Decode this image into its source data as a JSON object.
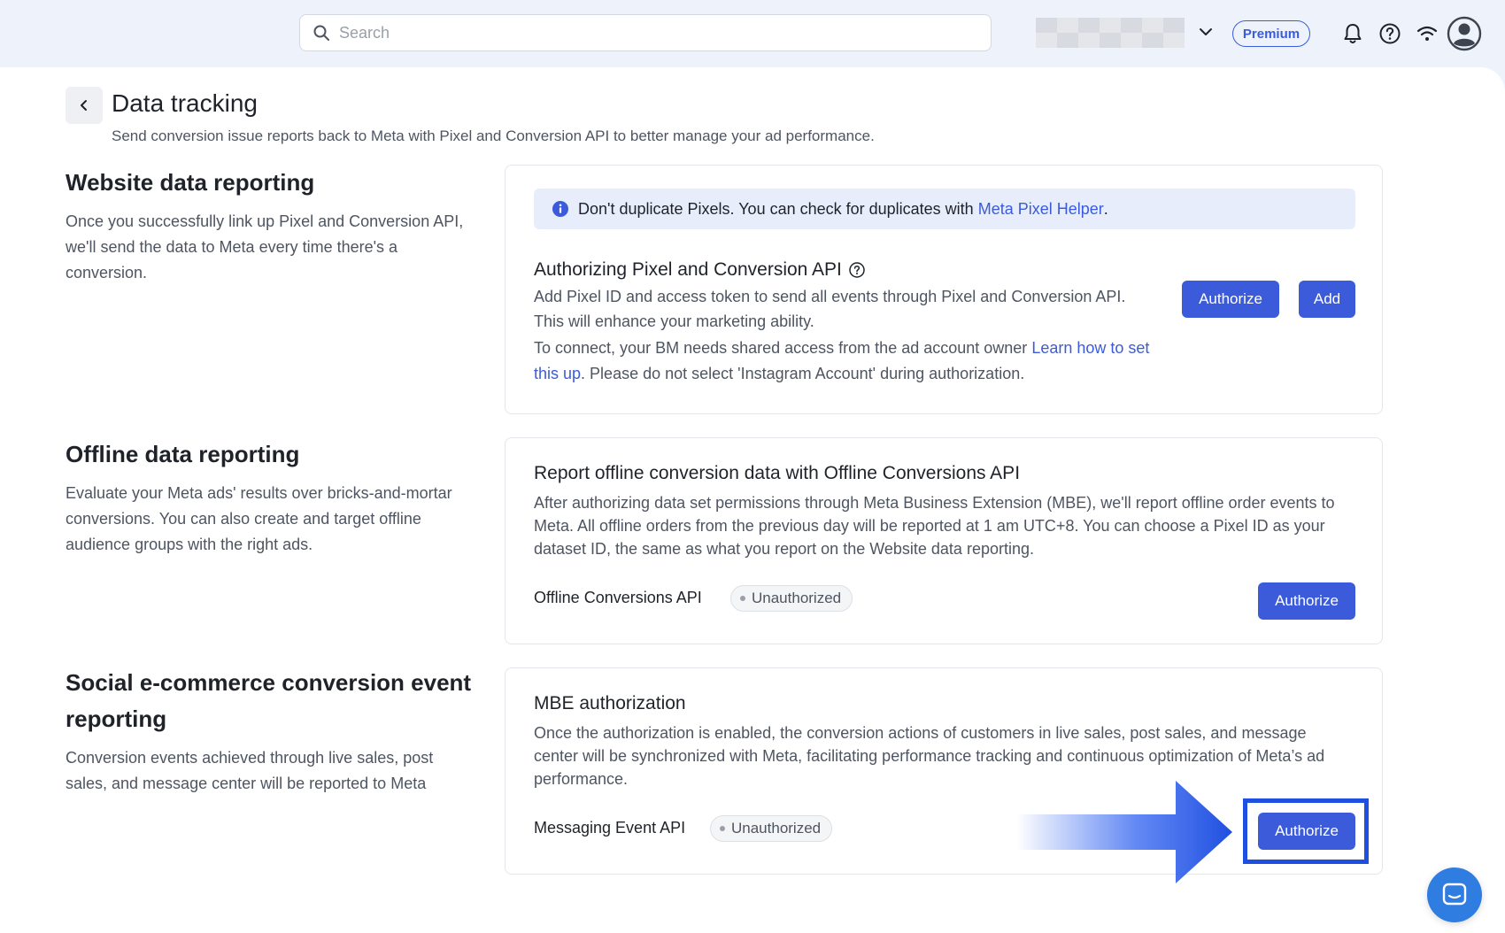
{
  "topbar": {
    "search_placeholder": "Search",
    "premium_label": "Premium",
    "icons": [
      "search-icon",
      "chevron-down-icon",
      "bell-icon",
      "help-icon",
      "wifi-icon",
      "user-avatar-icon"
    ]
  },
  "page": {
    "title": "Data tracking",
    "subtitle": "Send conversion issue reports back to Meta with Pixel and Conversion API to better manage your ad performance."
  },
  "sections": {
    "website": {
      "title": "Website data reporting",
      "desc": "Once you successfully link up Pixel and Conversion API, we'll send the data to Meta every time there's a conversion.",
      "notice_text": "Don't duplicate Pixels. You can check for duplicates with ",
      "notice_link": "Meta Pixel Helper",
      "notice_end": ".",
      "card_title": "Authorizing Pixel and Conversion API",
      "card_desc": "Add Pixel ID and access token to send all events through Pixel and Conversion API. This will enhance your marketing ability.",
      "connect_text": "To connect, your BM needs shared access from the ad account owner ",
      "connect_link": "Learn how to set this up",
      "connect_end": ". Please do not select 'Instagram Account' during authorization.",
      "authorize_label": "Authorize",
      "add_label": "Add"
    },
    "offline": {
      "title": "Offline data reporting",
      "desc": "Evaluate your Meta ads' results over bricks-and-mortar conversions. You can also create and target offline audience groups with the right ads.",
      "card_title": "Report offline conversion data with Offline Conversions API",
      "card_desc": "After authorizing data set permissions through Meta Business Extension (MBE), we'll report offline order events to Meta. All offline orders from the previous day will be reported at 1 am UTC+8. You can choose a Pixel ID as your dataset ID, the same as what you report on the Website data reporting.",
      "row_label": "Offline Conversions API",
      "status": "Unauthorized",
      "authorize_label": "Authorize"
    },
    "social": {
      "title": "Social e-commerce conversion event reporting",
      "desc": "Conversion events achieved through live sales, post sales, and message center will be reported to Meta",
      "card_title": "MBE authorization",
      "card_desc": "Once the authorization is enabled, the conversion actions of customers in live sales, post sales, and message center will be synchronized with Meta, facilitating performance tracking and continuous optimization of Meta’s ad performance.",
      "row_label": "Messaging Event API",
      "status": "Unauthorized",
      "authorize_label": "Authorize"
    }
  },
  "colors": {
    "accent": "#3b5bdb",
    "highlight": "#1f4fe0",
    "chat": "#2f7de1"
  }
}
